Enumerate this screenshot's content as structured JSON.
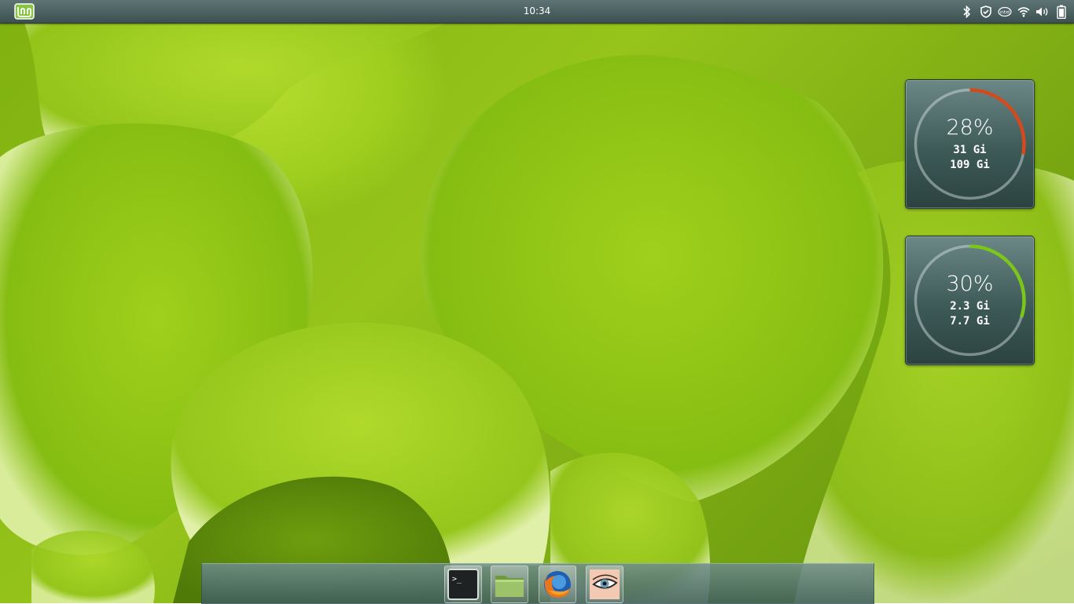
{
  "desktop": {
    "wallpaper": "green succulent leaves",
    "accent": "#8bc21a"
  },
  "top_panel": {
    "menu_icon": "linux-mint-menu-icon",
    "clock": "10:34",
    "tray_icons": [
      "bluetooth-icon",
      "shield-icon",
      "intel-icon",
      "wifi-icon",
      "volume-icon",
      "battery-icon"
    ]
  },
  "widgets": {
    "disk": {
      "percent_label": "28%",
      "used": "31 Gi",
      "total": "109 Gi",
      "fraction": 0.28,
      "color": "#d24a1e"
    },
    "memory": {
      "percent_label": "30%",
      "used": "2.3 Gi",
      "total": "7.7 Gi",
      "fraction": 0.3,
      "color": "#7cc61a"
    }
  },
  "dock": {
    "items": [
      {
        "name": "terminal-launcher",
        "icon": "terminal-icon",
        "glyph": ">_"
      },
      {
        "name": "files-launcher",
        "icon": "folder-icon"
      },
      {
        "name": "firefox-launcher",
        "icon": "firefox-icon"
      },
      {
        "name": "eye-of-gnome-launcher",
        "icon": "eye-icon"
      }
    ]
  }
}
